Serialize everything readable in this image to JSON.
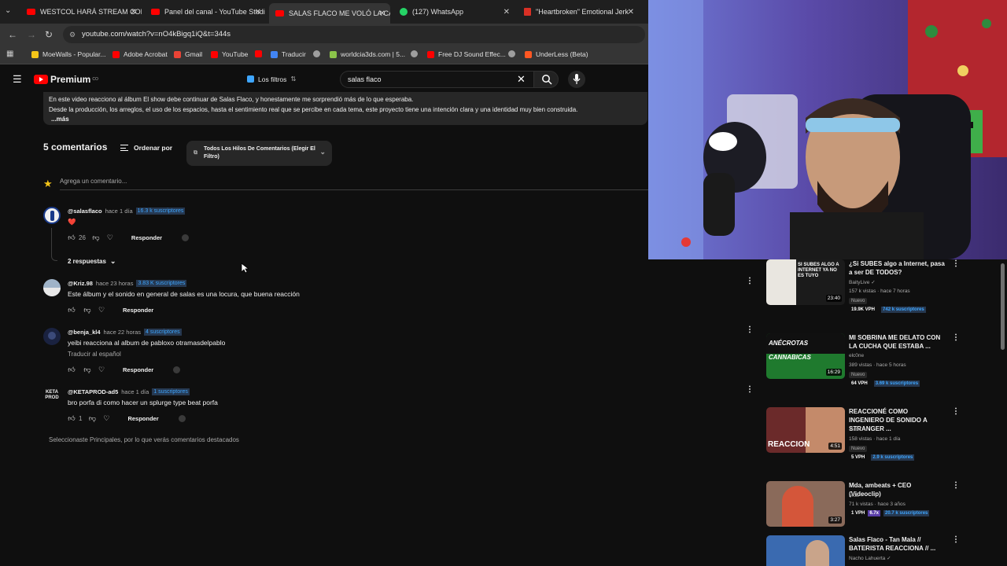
{
  "browser": {
    "tabs": [
      {
        "title": "WESTCOL HARÁ STREAM CON",
        "icon": "youtube-icon"
      },
      {
        "title": "Panel del canal - YouTube Studi",
        "icon": "youtube-studio-icon"
      },
      {
        "title": "SALAS FLACO ME VOLÓ LA CA",
        "icon": "youtube-icon",
        "active": true
      },
      {
        "title": "(127) WhatsApp",
        "icon": "whatsapp-icon"
      },
      {
        "title": "\"Heartbroken\" Emotional Jerk",
        "icon": "document-icon"
      }
    ],
    "url": "youtube.com/watch?v=nO4kBigq1iQ&t=344s",
    "bookmarks": [
      {
        "label": "MoeWalls - Popular...",
        "color": "#f5c518"
      },
      {
        "label": "Adobe Acrobat",
        "color": "#ff0000"
      },
      {
        "label": "Gmail",
        "color": "#ea4335"
      },
      {
        "label": "YouTube",
        "color": "#ff0000"
      },
      {
        "label": "",
        "color": "#ff0000"
      },
      {
        "label": "Traducir",
        "color": "#4285f4"
      },
      {
        "label": "",
        "color": "#9e9e9e"
      },
      {
        "label": "worldcia3ds.com | 5...",
        "color": "#8bc34a"
      },
      {
        "label": "",
        "color": "#9e9e9e"
      },
      {
        "label": "Free DJ Sound Effec...",
        "color": "#ff0000"
      },
      {
        "label": "",
        "color": "#9e9e9e"
      },
      {
        "label": "UnderLess (Beta)",
        "color": "#ff5722"
      }
    ]
  },
  "youtube": {
    "logo_text": "Premium",
    "logo_sup": "CO",
    "filters_label": "Los filtros",
    "search_value": "salas flaco"
  },
  "description": {
    "line1": "En este video reacciono al álbum El show debe continuar de Salas Flaco, y honestamente me sorprendió más de lo que esperaba.",
    "line2": "Desde la producción, los arreglos, el uso de los espacios, hasta el sentimiento real que se percibe en cada tema, este proyecto tiene una intención clara y una identidad muy bien construida.",
    "more": "...más"
  },
  "comments_header": {
    "count": "5 comentarios",
    "sort_label": "Ordenar por",
    "filter_label": "Todos Los Hilos De Comentarios (Elegir El Filtro)",
    "add_placeholder": "Agrega un comentario..."
  },
  "comments": [
    {
      "handle": "@salasflaco",
      "time": "hace 1 día",
      "subs": "16.3 k suscriptores",
      "text": "❤️",
      "likes": "26",
      "reply": "Responder",
      "replies_toggle": "2 respuestas"
    },
    {
      "handle": "@Kriz.98",
      "time": "hace 23 horas",
      "subs": "3.83 K suscriptores",
      "text": "Este álbum y el sonido en general de salas es una locura, que buena reacción",
      "likes": "",
      "reply": "Responder"
    },
    {
      "handle": "@benja_kl4",
      "time": "hace 22 horas",
      "subs": "4 suscriptores",
      "text": "yeibi reacciona al album de pabloxo otramasdelpablo",
      "translate": "Traducir al español",
      "likes": "",
      "reply": "Responder"
    },
    {
      "handle": "@KETAPROD-ad5",
      "time": "hace 1 día",
      "subs": "1 suscriptores",
      "text": "bro porfa di como hacer un splurge type beat porfa",
      "likes": "1",
      "reply": "Responder"
    }
  ],
  "footer_note": "Seleccionaste Principales, por lo que verás comentarios destacados",
  "recommendations": [
    {
      "title": "¿Si SUBES algo a Internet, pasa a ser DE TODOS?",
      "channel": "BaityLive",
      "views": "157 k vistas · hace 7 horas",
      "badge": "Nuevo",
      "duration": "23:40",
      "thumb_text": "SI SUBES ALGO A INTERNET YA NO ES TUYO",
      "stat1": "19.9K VPH",
      "stat2": "",
      "stat3": "742 k suscriptores",
      "thumb_color": "#1b1b1b"
    },
    {
      "title": "MI SOBRINA ME DELATO CON LA CUCHA QUE ESTABA ...",
      "channel": "elc0ne",
      "views": "389 vistas · hace 5 horas",
      "badge": "Nuevo",
      "duration": "16:29",
      "thumb_text": "ANÉCROTAS CANNABICAS",
      "stat1": "64 VPH",
      "stat2": "",
      "stat3": "3.69 k suscriptores",
      "thumb_color": "#1f7a2e"
    },
    {
      "title": "REACCIONÉ COMO INGENIERO DE SONIDO A STRANGER ...",
      "channel": "Yeibi",
      "views": "158 vistas · hace 1 día",
      "badge": "Nuevo",
      "duration": "4:51",
      "thumb_text": "REACCION",
      "stat1": "5 VPH",
      "stat2": "",
      "stat3": "2.9 k suscriptores",
      "thumb_color": "#6b2a2a"
    },
    {
      "title": "Mda, ambeats + CEO (Videoclip)",
      "channel": "Mda",
      "views": "71 k vistas · hace 3 años",
      "badge": "",
      "duration": "3:27",
      "thumb_text": "",
      "stat1": "1 VPH",
      "stat2": "6.7x",
      "stat3": "20.7 k suscriptores",
      "thumb_color": "#8a6a5a"
    },
    {
      "title": "Salas Flaco - Tan Mala // BATERISTA REACCIONA // ...",
      "channel": "Nacho Lahuerta",
      "views": "",
      "badge": "",
      "duration": "",
      "thumb_text": "",
      "stat1": "",
      "stat2": "",
      "stat3": "",
      "thumb_color": "#3a6ab0"
    }
  ]
}
